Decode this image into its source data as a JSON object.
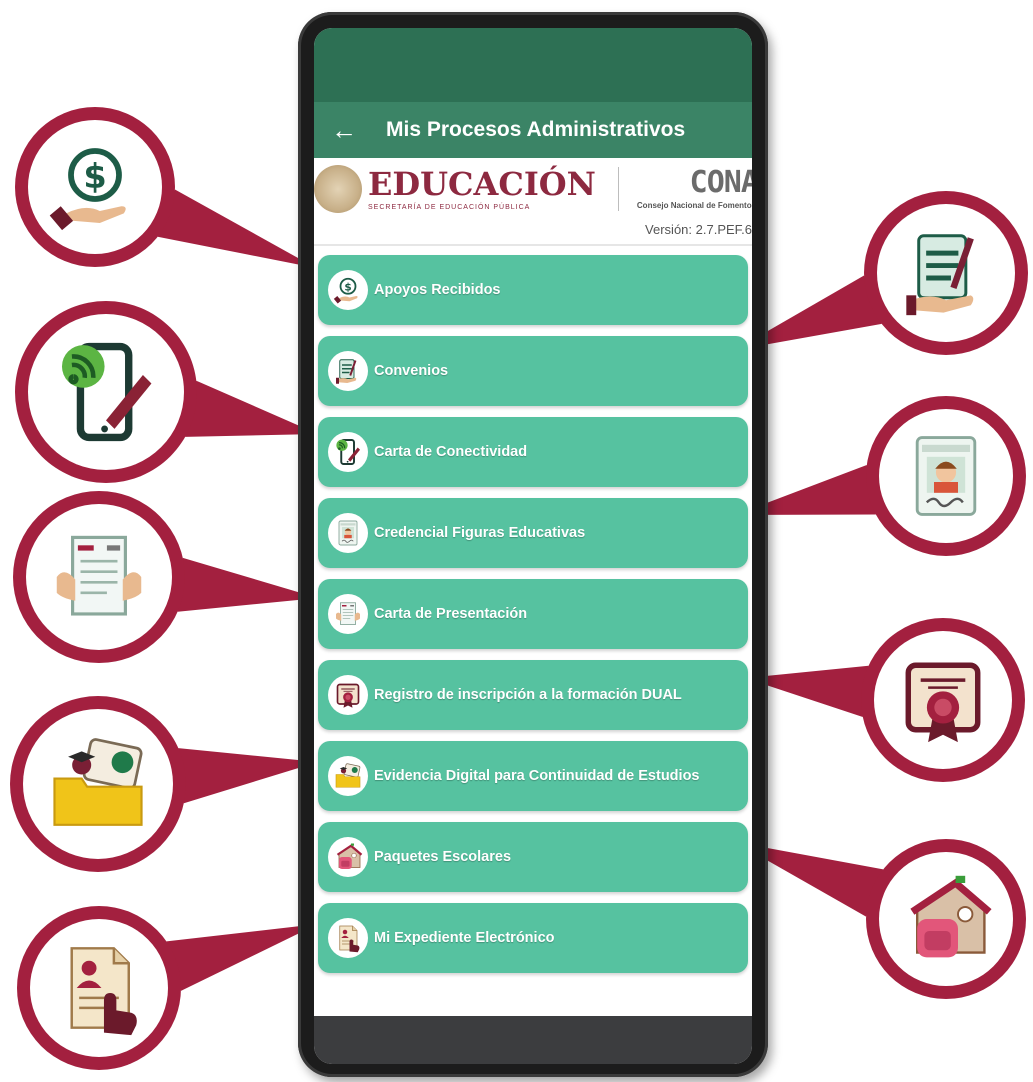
{
  "colors": {
    "status_bar": "#2d7054",
    "app_bar": "#3b8466",
    "menu_item": "#56c2a0",
    "callout": "#a3203f",
    "sep_brand": "#8d2940",
    "nav_bar": "#3c3d3f"
  },
  "appbar": {
    "back_icon": "←",
    "title": "Mis Procesos Administrativos"
  },
  "header": {
    "sep_logo": "EDUCACIÓN",
    "sep_subtitle": "SECRETARÍA DE EDUCACIÓN PÚBLICA",
    "conafe_logo": "CONAFE",
    "conafe_subtitle": "Consejo Nacional de Fomento Educativo",
    "version": "Versión: 2.7.PEF.6"
  },
  "menu": [
    {
      "label": "Apoyos Recibidos",
      "icon": "money-hand-icon"
    },
    {
      "label": "Convenios",
      "icon": "contract-sign-icon"
    },
    {
      "label": "Carta de Conectividad",
      "icon": "phone-signal-icon"
    },
    {
      "label": "Credencial Figuras Educativas",
      "icon": "id-card-icon"
    },
    {
      "label": "Carta de Presentación",
      "icon": "letter-document-icon"
    },
    {
      "label": "Registro de inscripción a la formación DUAL",
      "icon": "certificate-icon"
    },
    {
      "label": "Evidencia Digital para Continuidad de Estudios",
      "icon": "folder-evidence-icon"
    },
    {
      "label": "Paquetes Escolares",
      "icon": "school-backpack-icon"
    },
    {
      "label": "Mi Expediente Electrónico",
      "icon": "electronic-file-icon"
    }
  ],
  "callouts": [
    {
      "icon": "money-hand-icon",
      "target": "Apoyos Recibidos"
    },
    {
      "icon": "contract-sign-icon",
      "target": "Convenios"
    },
    {
      "icon": "phone-signal-icon",
      "target": "Carta de Conectividad"
    },
    {
      "icon": "id-card-icon",
      "target": "Credencial Figuras Educativas"
    },
    {
      "icon": "letter-document-icon",
      "target": "Carta de Presentación"
    },
    {
      "icon": "certificate-icon",
      "target": "Registro de inscripción a la formación DUAL"
    },
    {
      "icon": "folder-evidence-icon",
      "target": "Evidencia Digital para Continuidad de Estudios"
    },
    {
      "icon": "school-backpack-icon",
      "target": "Paquetes Escolares"
    },
    {
      "icon": "electronic-file-icon",
      "target": "Mi Expediente Electrónico"
    }
  ]
}
